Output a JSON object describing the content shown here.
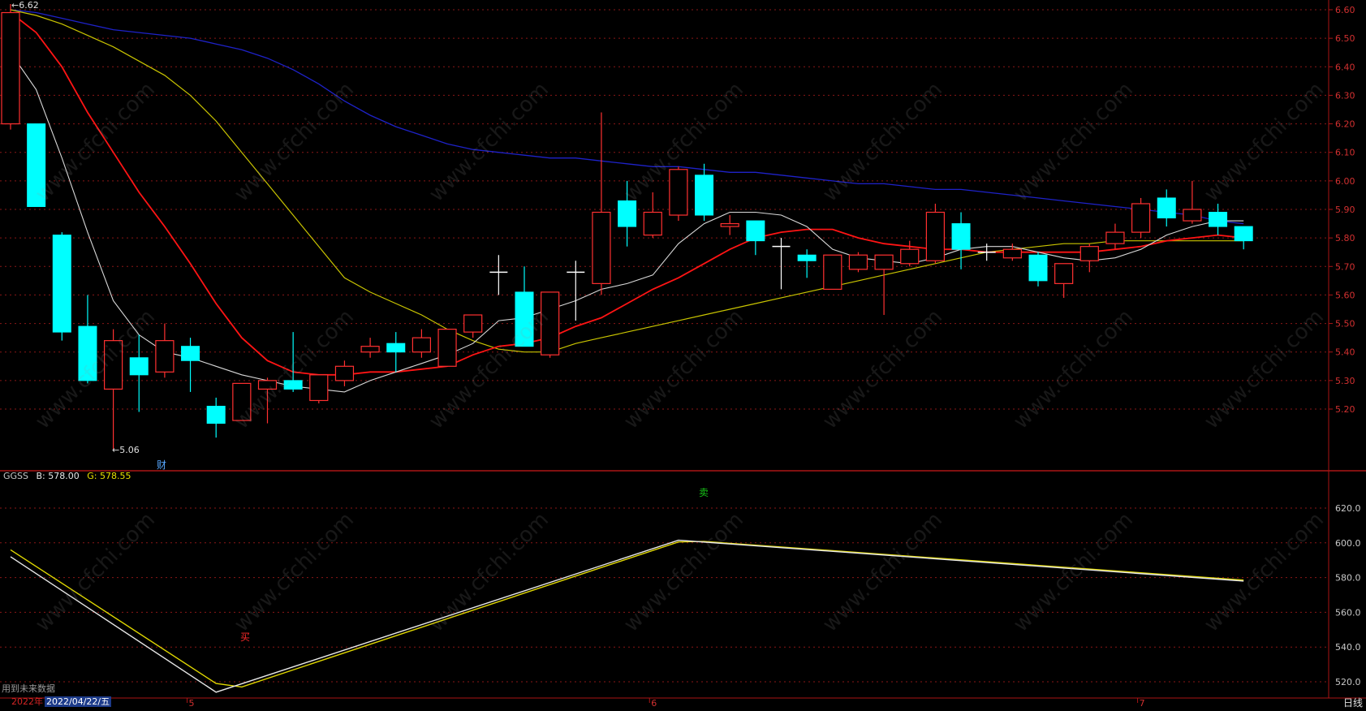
{
  "colors": {
    "bg": "#000000",
    "frame": "#aa1515",
    "grid": "#8a1717",
    "up": "#ff3030",
    "down": "#00ffff",
    "doji": "#ffffff",
    "ma_white": "#d8d8d8",
    "ma_red": "#ff1414",
    "ma_yellow": "#c9c400",
    "ma_blue": "#1e22c8",
    "ind_b": "#e8e8e8",
    "ind_g": "#e0d800"
  },
  "price_panel": {
    "high_label": "6.62",
    "low_label": "5.06",
    "finance_badge": "财",
    "y_ticks": [
      "6.60",
      "6.50",
      "6.40",
      "6.30",
      "6.20",
      "6.10",
      "6.00",
      "5.90",
      "5.80",
      "5.70",
      "5.60",
      "5.50",
      "5.40",
      "5.30",
      "5.20"
    ]
  },
  "indicator_panel": {
    "name": "GGSS",
    "b_text": "B: 578.00",
    "g_text": "G: 578.55",
    "buy_label": "买",
    "sell_label": "卖",
    "y_ticks": [
      "620.0",
      "600.0",
      "580.0",
      "560.0",
      "540.0",
      "520.0"
    ]
  },
  "footer": {
    "future_data_note": "用到未来数据",
    "year": "2022年",
    "date": "2022/04/22/五",
    "month_marks": [
      "5",
      "6",
      "7"
    ],
    "period": "日线"
  },
  "watermark": "www.cfchi.com",
  "chart_data": {
    "type": "candlestick",
    "ylim": [
      5.06,
      6.62
    ],
    "candles": [
      {
        "o": 6.2,
        "c": 6.59,
        "h": 6.62,
        "l": 6.18
      },
      {
        "o": 6.2,
        "c": 5.91,
        "h": 6.2,
        "l": 5.91
      },
      {
        "o": 5.81,
        "c": 5.47,
        "h": 5.82,
        "l": 5.44
      },
      {
        "o": 5.49,
        "c": 5.3,
        "h": 5.6,
        "l": 5.29
      },
      {
        "o": 5.27,
        "c": 5.44,
        "h": 5.48,
        "l": 5.06
      },
      {
        "o": 5.38,
        "c": 5.32,
        "h": 5.46,
        "l": 5.19
      },
      {
        "o": 5.33,
        "c": 5.44,
        "h": 5.5,
        "l": 5.31
      },
      {
        "o": 5.42,
        "c": 5.37,
        "h": 5.45,
        "l": 5.26
      },
      {
        "o": 5.21,
        "c": 5.15,
        "h": 5.24,
        "l": 5.1
      },
      {
        "o": 5.16,
        "c": 5.29,
        "h": 5.29,
        "l": 5.16
      },
      {
        "o": 5.27,
        "c": 5.3,
        "h": 5.31,
        "l": 5.15
      },
      {
        "o": 5.3,
        "c": 5.27,
        "h": 5.47,
        "l": 5.26
      },
      {
        "o": 5.23,
        "c": 5.32,
        "h": 5.32,
        "l": 5.22
      },
      {
        "o": 5.3,
        "c": 5.35,
        "h": 5.37,
        "l": 5.28
      },
      {
        "o": 5.4,
        "c": 5.42,
        "h": 5.45,
        "l": 5.38
      },
      {
        "o": 5.43,
        "c": 5.4,
        "h": 5.47,
        "l": 5.33
      },
      {
        "o": 5.4,
        "c": 5.45,
        "h": 5.48,
        "l": 5.38
      },
      {
        "o": 5.35,
        "c": 5.48,
        "h": 5.48,
        "l": 5.35
      },
      {
        "o": 5.47,
        "c": 5.53,
        "h": 5.53,
        "l": 5.45
      },
      {
        "o": 5.68,
        "c": 5.68,
        "h": 5.74,
        "l": 5.6
      },
      {
        "o": 5.61,
        "c": 5.42,
        "h": 5.7,
        "l": 5.42
      },
      {
        "o": 5.39,
        "c": 5.61,
        "h": 5.61,
        "l": 5.38
      },
      {
        "o": 5.68,
        "c": 5.68,
        "h": 5.72,
        "l": 5.51
      },
      {
        "o": 5.64,
        "c": 5.89,
        "h": 6.24,
        "l": 5.6
      },
      {
        "o": 5.93,
        "c": 5.84,
        "h": 6.0,
        "l": 5.77
      },
      {
        "o": 5.81,
        "c": 5.89,
        "h": 5.96,
        "l": 5.8
      },
      {
        "o": 5.88,
        "c": 6.04,
        "h": 6.05,
        "l": 5.86
      },
      {
        "o": 6.02,
        "c": 5.88,
        "h": 6.06,
        "l": 5.86
      },
      {
        "o": 5.84,
        "c": 5.85,
        "h": 5.88,
        "l": 5.81
      },
      {
        "o": 5.86,
        "c": 5.79,
        "h": 5.86,
        "l": 5.74
      },
      {
        "o": 5.77,
        "c": 5.77,
        "h": 5.8,
        "l": 5.62
      },
      {
        "o": 5.74,
        "c": 5.72,
        "h": 5.76,
        "l": 5.66
      },
      {
        "o": 5.62,
        "c": 5.74,
        "h": 5.74,
        "l": 5.62
      },
      {
        "o": 5.69,
        "c": 5.74,
        "h": 5.75,
        "l": 5.68
      },
      {
        "o": 5.69,
        "c": 5.74,
        "h": 5.74,
        "l": 5.53
      },
      {
        "o": 5.71,
        "c": 5.76,
        "h": 5.79,
        "l": 5.7
      },
      {
        "o": 5.72,
        "c": 5.89,
        "h": 5.92,
        "l": 5.71
      },
      {
        "o": 5.85,
        "c": 5.76,
        "h": 5.89,
        "l": 5.69
      },
      {
        "o": 5.75,
        "c": 5.75,
        "h": 5.78,
        "l": 5.72
      },
      {
        "o": 5.73,
        "c": 5.76,
        "h": 5.78,
        "l": 5.72
      },
      {
        "o": 5.74,
        "c": 5.65,
        "h": 5.75,
        "l": 5.63
      },
      {
        "o": 5.64,
        "c": 5.71,
        "h": 5.71,
        "l": 5.59
      },
      {
        "o": 5.72,
        "c": 5.77,
        "h": 5.78,
        "l": 5.68
      },
      {
        "o": 5.78,
        "c": 5.82,
        "h": 5.85,
        "l": 5.76
      },
      {
        "o": 5.82,
        "c": 5.92,
        "h": 5.94,
        "l": 5.8
      },
      {
        "o": 5.94,
        "c": 5.87,
        "h": 5.97,
        "l": 5.84
      },
      {
        "o": 5.86,
        "c": 5.9,
        "h": 6.0,
        "l": 5.85
      },
      {
        "o": 5.89,
        "c": 5.84,
        "h": 5.92,
        "l": 5.81
      },
      {
        "o": 5.84,
        "c": 5.79,
        "h": 5.84,
        "l": 5.76
      }
    ],
    "ma_white": [
      6.45,
      6.32,
      6.08,
      5.82,
      5.58,
      5.46,
      5.4,
      5.38,
      5.35,
      5.32,
      5.3,
      5.28,
      5.27,
      5.26,
      5.3,
      5.33,
      5.36,
      5.39,
      5.43,
      5.51,
      5.52,
      5.55,
      5.58,
      5.62,
      5.64,
      5.67,
      5.78,
      5.85,
      5.89,
      5.89,
      5.88,
      5.84,
      5.76,
      5.73,
      5.72,
      5.71,
      5.73,
      5.76,
      5.77,
      5.77,
      5.75,
      5.73,
      5.72,
      5.73,
      5.76,
      5.81,
      5.84,
      5.86,
      5.86
    ],
    "ma_red": [
      6.59,
      6.52,
      6.4,
      6.24,
      6.1,
      5.96,
      5.84,
      5.71,
      5.57,
      5.45,
      5.37,
      5.33,
      5.32,
      5.32,
      5.33,
      5.33,
      5.34,
      5.35,
      5.39,
      5.42,
      5.43,
      5.45,
      5.49,
      5.52,
      5.57,
      5.62,
      5.66,
      5.71,
      5.76,
      5.8,
      5.82,
      5.83,
      5.83,
      5.8,
      5.78,
      5.77,
      5.76,
      5.76,
      5.75,
      5.75,
      5.75,
      5.75,
      5.75,
      5.76,
      5.77,
      5.79,
      5.8,
      5.81,
      5.8
    ],
    "ma_yellow": [
      6.6,
      6.58,
      6.55,
      6.51,
      6.47,
      6.42,
      6.37,
      6.3,
      6.21,
      6.1,
      5.99,
      5.88,
      5.77,
      5.66,
      5.61,
      5.57,
      5.53,
      5.48,
      5.44,
      5.41,
      5.4,
      5.4,
      5.43,
      5.45,
      5.47,
      5.49,
      5.51,
      5.53,
      5.55,
      5.57,
      5.59,
      5.61,
      5.63,
      5.65,
      5.67,
      5.69,
      5.71,
      5.73,
      5.75,
      5.76,
      5.77,
      5.78,
      5.78,
      5.79,
      5.79,
      5.79,
      5.79,
      5.79,
      5.79
    ],
    "ma_blue": [
      6.6,
      6.59,
      6.57,
      6.55,
      6.53,
      6.52,
      6.51,
      6.5,
      6.48,
      6.46,
      6.43,
      6.39,
      6.34,
      6.28,
      6.23,
      6.19,
      6.16,
      6.13,
      6.11,
      6.1,
      6.09,
      6.08,
      6.08,
      6.07,
      6.06,
      6.05,
      6.05,
      6.04,
      6.03,
      6.03,
      6.02,
      6.01,
      6.0,
      5.99,
      5.99,
      5.98,
      5.97,
      5.97,
      5.96,
      5.95,
      5.94,
      5.93,
      5.92,
      5.91,
      5.9,
      5.89,
      5.88,
      5.86,
      5.85
    ],
    "indicator": {
      "ylim": [
        510,
        630
      ],
      "b": [
        {
          "i": 0,
          "v": 592
        },
        {
          "i": 8,
          "v": 514
        },
        {
          "i": 26,
          "v": 601.5
        },
        {
          "i": 48,
          "v": 578
        }
      ],
      "g": [
        {
          "i": 0,
          "v": 596
        },
        {
          "i": 8,
          "v": 519
        },
        {
          "i": 9,
          "v": 517
        },
        {
          "i": 26,
          "v": 600.5
        },
        {
          "i": 27,
          "v": 600.8
        },
        {
          "i": 48,
          "v": 578.55
        }
      ]
    }
  }
}
